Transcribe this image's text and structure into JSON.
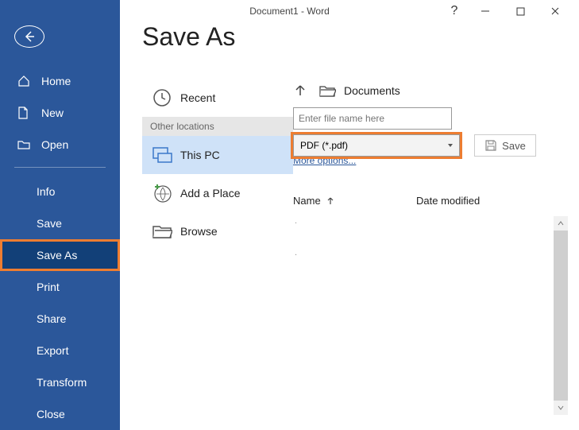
{
  "window": {
    "title": "Document1  -  Word"
  },
  "sidebar": {
    "primary": [
      {
        "label": "Home"
      },
      {
        "label": "New"
      },
      {
        "label": "Open"
      }
    ],
    "secondary": [
      {
        "label": "Info"
      },
      {
        "label": "Save"
      },
      {
        "label": "Save As"
      },
      {
        "label": "Print"
      },
      {
        "label": "Share"
      },
      {
        "label": "Export"
      },
      {
        "label": "Transform"
      },
      {
        "label": "Close"
      }
    ]
  },
  "page": {
    "title": "Save As"
  },
  "locations": {
    "recent": "Recent",
    "other_header": "Other locations",
    "this_pc": "This PC",
    "add_place": "Add a Place",
    "browse": "Browse"
  },
  "right": {
    "path_label": "Documents",
    "filename_placeholder": "Enter file name here",
    "filetype": "PDF (*.pdf)",
    "save_label": "Save",
    "more_options": "More options...",
    "columns": {
      "name": "Name",
      "date": "Date modified"
    }
  }
}
